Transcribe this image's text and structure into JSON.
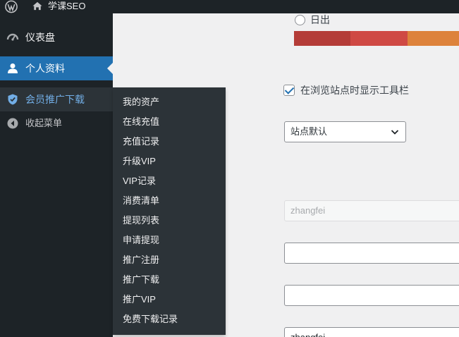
{
  "adminbar": {
    "site_name": "学课SEO",
    "icons": [
      "wordpress-logo-icon",
      "home-icon"
    ]
  },
  "sidebar": {
    "items": [
      {
        "label": "仪表盘",
        "icon": "dashboard-icon"
      },
      {
        "label": "个人资料",
        "icon": "user-icon"
      },
      {
        "label": "会员推广下载",
        "icon": "shield-icon"
      },
      {
        "label": "收起菜单",
        "icon": "collapse-arrow-icon"
      }
    ]
  },
  "flyout": {
    "items": [
      "我的资产",
      "在线充值",
      "充值记录",
      "升级VIP",
      "VIP记录",
      "消费清单",
      "提现列表",
      "申请提现",
      "推广注册",
      "推广下载",
      "推广VIP",
      "免费下载记录"
    ]
  },
  "profile": {
    "color_scheme_option": "日出",
    "toolbar_label": "在浏览站点时显示工具栏",
    "toolbar_checked": true,
    "language_select": "站点默认",
    "username_value": "zhangfei",
    "nickname_value": "zhangfei"
  },
  "colors": {
    "adminbar_bg": "#1d2327",
    "sidebar_bg": "#1d2327",
    "active_blue": "#2271b1",
    "submenu_bg": "#2c3338",
    "highlight_text": "#72aee6",
    "sunrise_swatches": [
      "#b43c38",
      "#cf4944",
      "#dd823b"
    ]
  }
}
